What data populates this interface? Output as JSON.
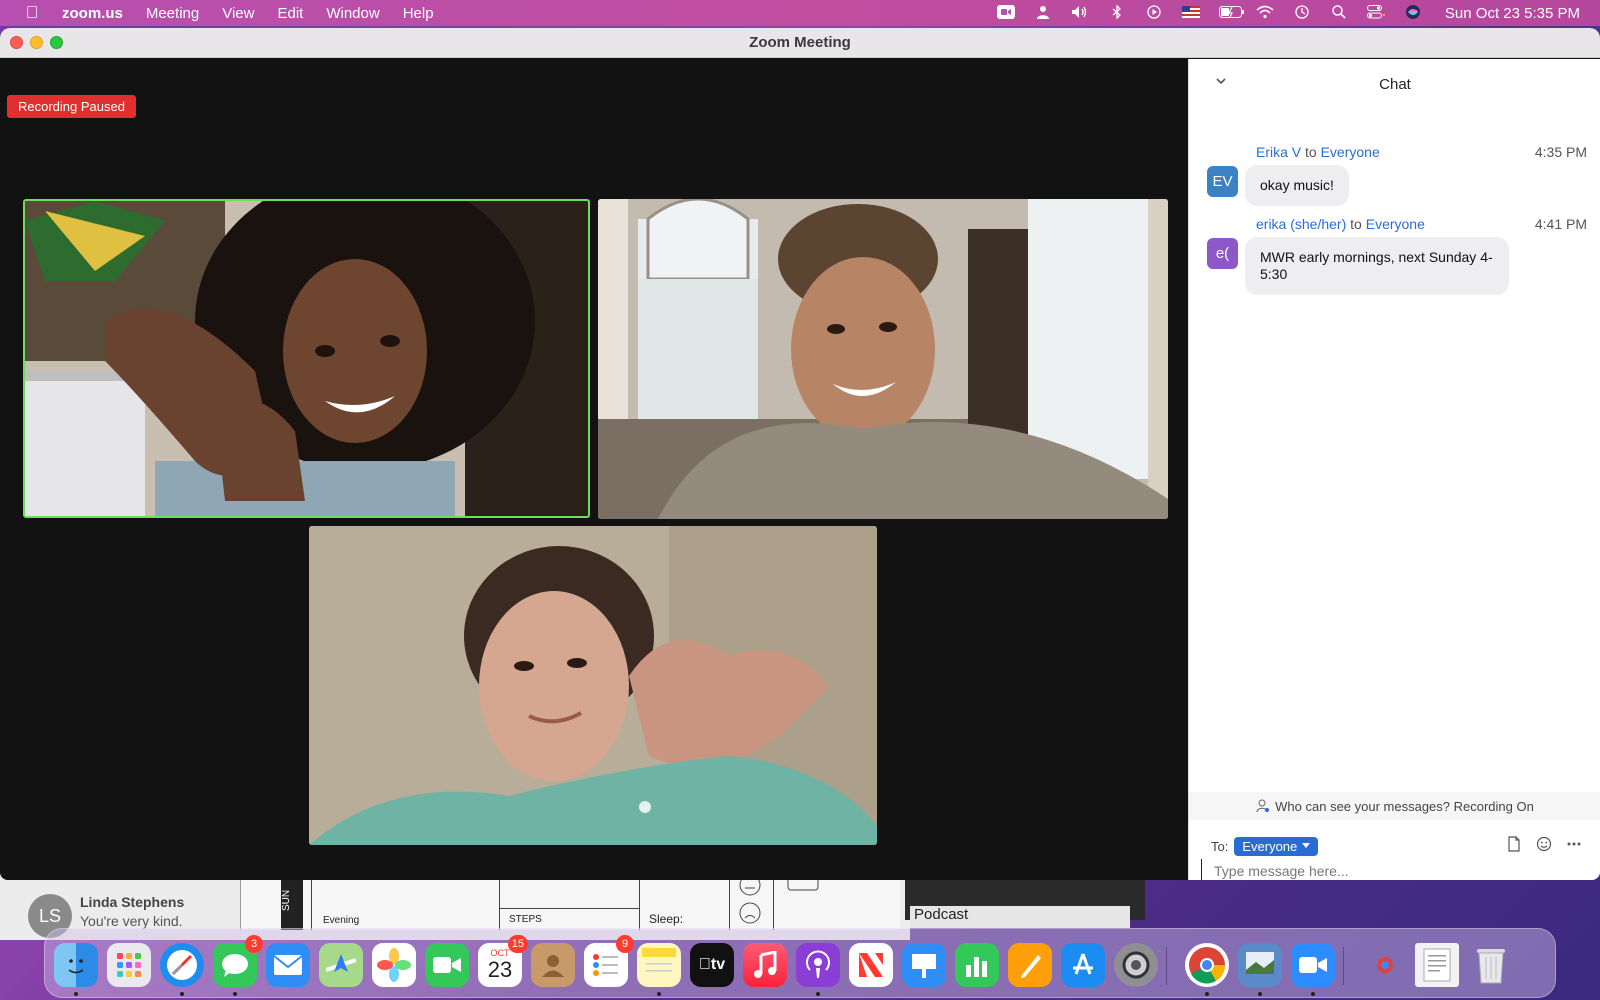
{
  "menubar": {
    "app_name": "zoom.us",
    "menus": [
      "Meeting",
      "View",
      "Edit",
      "Window",
      "Help"
    ],
    "clock": "Sun Oct 23  5:35 PM"
  },
  "window": {
    "title": "Zoom Meeting"
  },
  "gallery": {
    "recording_badge": "Recording Paused"
  },
  "chat": {
    "title": "Chat",
    "messages": [
      {
        "initials": "EV",
        "avatar_color": "#3b82c4",
        "sender": "Erika V",
        "to_word": "to",
        "recipient": "Everyone",
        "time": "4:35 PM",
        "text": "okay music!"
      },
      {
        "initials": "e(",
        "avatar_color": "#8e57c7",
        "sender": "erika (she/her)",
        "to_word": "to",
        "recipient": "Everyone",
        "time": "4:41 PM",
        "text": "MWR early mornings, next Sunday 4-5:30"
      }
    ],
    "visibility_note": "Who can see your messages? Recording On",
    "to_label": "To:",
    "to_value": "Everyone",
    "input_placeholder": "Type message here..."
  },
  "background": {
    "contact_initials": "LS",
    "contact_name": "Linda Stephens",
    "contact_message": "You're very kind.",
    "doc_day": "SUN",
    "doc_evening": "Evening",
    "doc_steps": "STEPS",
    "doc_sleep": "Sleep:",
    "podcast_label": "Podcast"
  },
  "dock": {
    "calendar_month": "OCT",
    "calendar_day": "23",
    "messages_badge": "3",
    "calendar_badge": "15",
    "reminders_badge": "9",
    "tv_label": "tv"
  },
  "colors": {
    "menubar": "#b74fb0",
    "accent_blue": "#2a6dd2",
    "recording_red": "#e02f2f",
    "active_speaker": "#6dde5a"
  }
}
